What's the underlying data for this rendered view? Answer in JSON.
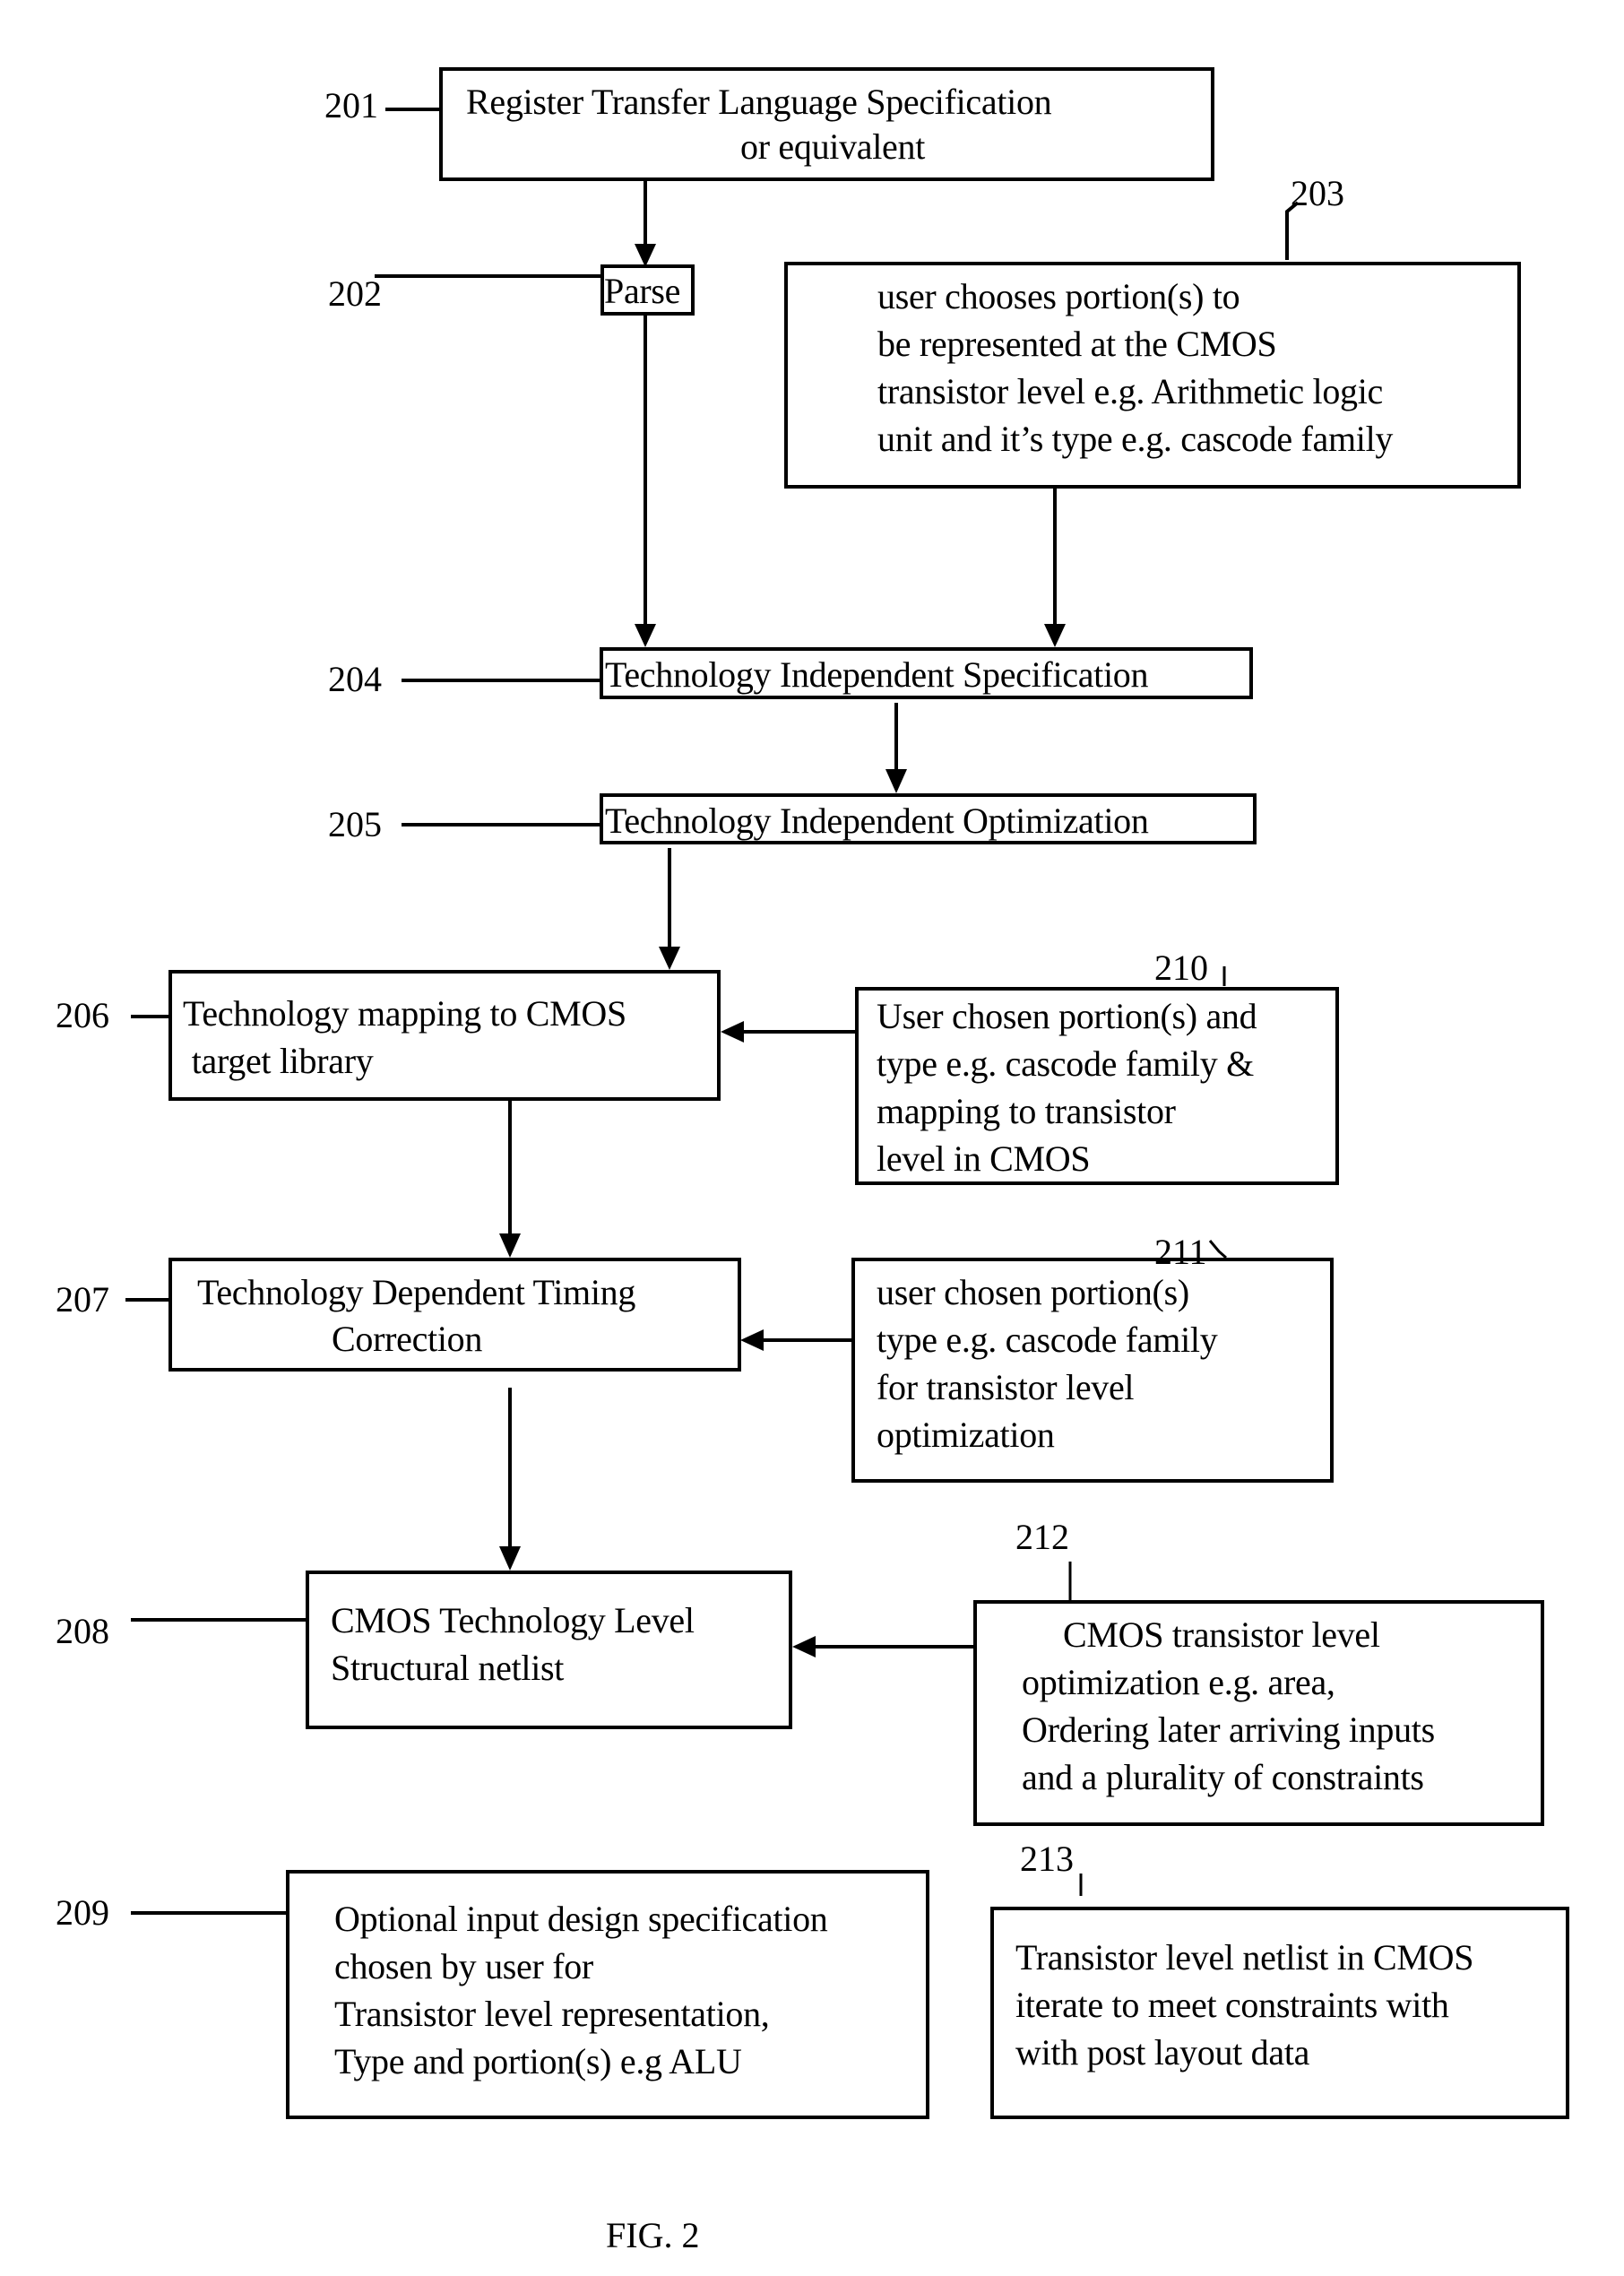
{
  "figure": {
    "caption": "FIG. 2",
    "steps": {
      "s201": {
        "ref": "201",
        "lines": [
          "Register Transfer Language Specification",
          "or equivalent"
        ]
      },
      "s202": {
        "ref": "202",
        "lines": [
          "Parse"
        ]
      },
      "s203": {
        "ref": "203",
        "lines": [
          "user chooses portion(s) to",
          "be represented at the CMOS",
          "transistor level e.g. Arithmetic logic",
          "unit and it’s type e.g. cascode family"
        ]
      },
      "s204": {
        "ref": "204",
        "lines": [
          "Technology Independent Specification"
        ]
      },
      "s205": {
        "ref": "205",
        "lines": [
          "Technology Independent Optimization"
        ]
      },
      "s206": {
        "ref": "206",
        "lines": [
          "Technology mapping to CMOS",
          " target library"
        ]
      },
      "s207": {
        "ref": "207",
        "lines": [
          "Technology Dependent Timing",
          "Correction"
        ]
      },
      "s208": {
        "ref": "208",
        "lines": [
          "CMOS Technology Level",
          "Structural netlist"
        ]
      },
      "s209": {
        "ref": "209",
        "lines": [
          "Optional input design specification",
          "chosen by user for",
          "Transistor level representation,",
          "Type and portion(s) e.g ALU"
        ]
      },
      "s210": {
        "ref": "210",
        "lines": [
          "User chosen portion(s) and",
          "type e.g. cascode family &",
          "mapping to transistor",
          "level in CMOS"
        ]
      },
      "s211": {
        "ref": "211",
        "lines": [
          "user chosen portion(s)",
          "type e.g. cascode family",
          "for transistor level",
          "optimization"
        ]
      },
      "s212": {
        "ref": "212",
        "lines": [
          "CMOS transistor level",
          "optimization e.g. area,",
          "Ordering later arriving inputs",
          "and a plurality of constraints"
        ]
      },
      "s213": {
        "ref": "213",
        "lines": [
          "Transistor level netlist in CMOS",
          "iterate to meet constraints with",
          "with post layout data"
        ]
      }
    },
    "edges": [
      {
        "from": "201",
        "to": "202"
      },
      {
        "from": "202",
        "to": "204"
      },
      {
        "from": "203",
        "to": "204"
      },
      {
        "from": "204",
        "to": "205"
      },
      {
        "from": "205",
        "to": "206"
      },
      {
        "from": "210",
        "to": "206"
      },
      {
        "from": "206",
        "to": "207"
      },
      {
        "from": "211",
        "to": "207"
      },
      {
        "from": "207",
        "to": "208"
      },
      {
        "from": "212",
        "to": "208"
      }
    ]
  }
}
